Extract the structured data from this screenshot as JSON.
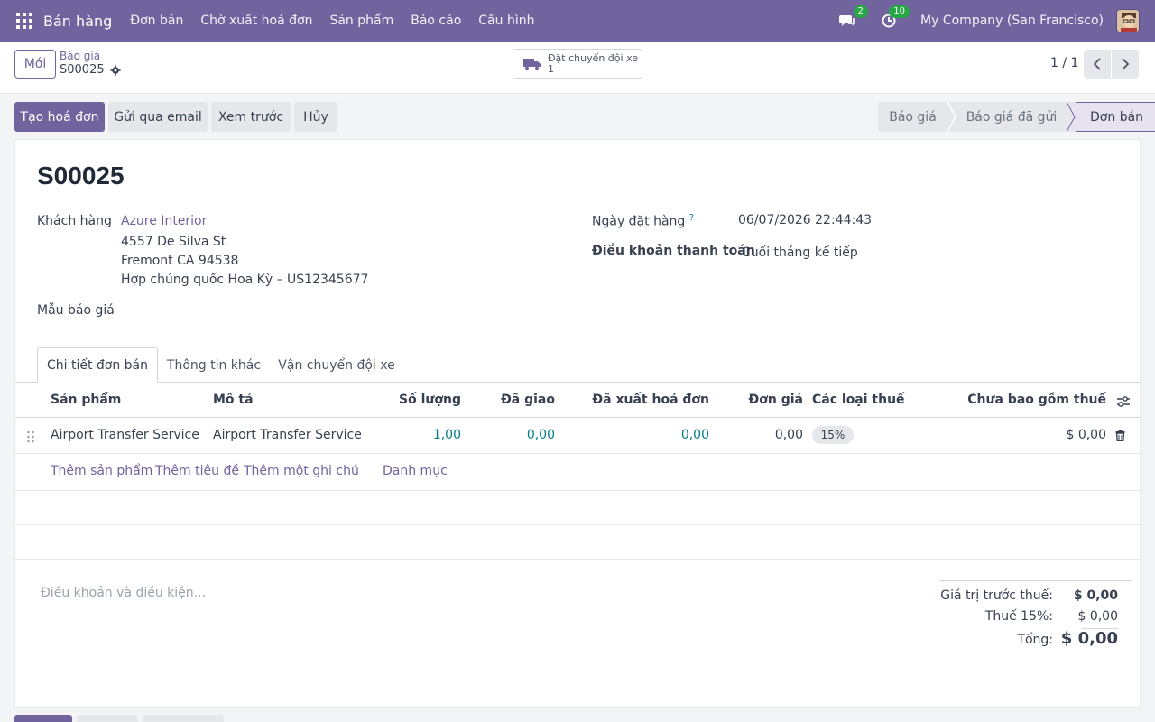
{
  "navbar": {
    "brand": "Bán hàng",
    "menu": [
      "Đơn bán",
      "Chờ xuất hoá đơn",
      "Sản phẩm",
      "Báo cáo",
      "Cấu hình"
    ],
    "messages_count": "2",
    "activities_count": "10",
    "company": "My Company (San Francisco)"
  },
  "control": {
    "new_label": "Mới",
    "breadcrumb_parent": "Báo giá",
    "breadcrumb_current": "S00025",
    "smart_button_label": "Đặt chuyến đội xe",
    "smart_button_count": "1",
    "pager": "1 / 1"
  },
  "actions": {
    "create_invoice": "Tạo hoá đơn",
    "send_email": "Gửi qua email",
    "preview": "Xem trước",
    "cancel": "Hủy"
  },
  "status": [
    "Báo giá",
    "Báo giá đã gửi",
    "Đơn bán"
  ],
  "form": {
    "title": "S00025",
    "customer_label": "Khách hàng",
    "customer_name": "Azure Interior",
    "address_line1": "4557 De Silva St",
    "address_line2": "Fremont CA 94538",
    "address_line3": "Hợp chủng quốc Hoa Kỳ – US12345677",
    "quote_template_label": "Mẫu báo giá",
    "order_date_label": "Ngày đặt hàng",
    "order_date_help": "?",
    "order_date": "06/07/2026 22:44:43",
    "payment_terms_label": "Điều khoản thanh toán",
    "payment_terms": "Cuối tháng kế tiếp"
  },
  "tabs": [
    "Chi tiết đơn bán",
    "Thông tin khác",
    "Vận chuyển đội xe"
  ],
  "table": {
    "headers": [
      "Sản phẩm",
      "Mô tả",
      "Số lượng",
      "Đã giao",
      "Đã xuất hoá đơn",
      "Đơn giá",
      "Các loại thuế",
      "Chưa bao gồm thuế"
    ],
    "rows": [
      {
        "product": "Airport Transfer Service",
        "description": "Airport Transfer Service",
        "quantity": "1,00",
        "delivered": "0,00",
        "invoiced": "0,00",
        "unit_price": "0,00",
        "taxes": "15%",
        "subtotal": "$ 0,00"
      }
    ],
    "add_links": [
      "Thêm sản phẩm",
      "Thêm tiêu đề",
      "Thêm một ghi chú",
      "Danh mục"
    ]
  },
  "terms_placeholder": "Điều khoản và điều kiện...",
  "totals": {
    "untaxed_label": "Giá trị trước thuế:",
    "untaxed_value": "$ 0,00",
    "tax_label": "Thuế 15%:",
    "tax_value": "$ 0,00",
    "total_label": "Tổng:",
    "total_value": "$ 0,00"
  },
  "colors": {
    "brand": "#71639e",
    "link_teal": "#017e84",
    "badge_green": "#28a745"
  }
}
